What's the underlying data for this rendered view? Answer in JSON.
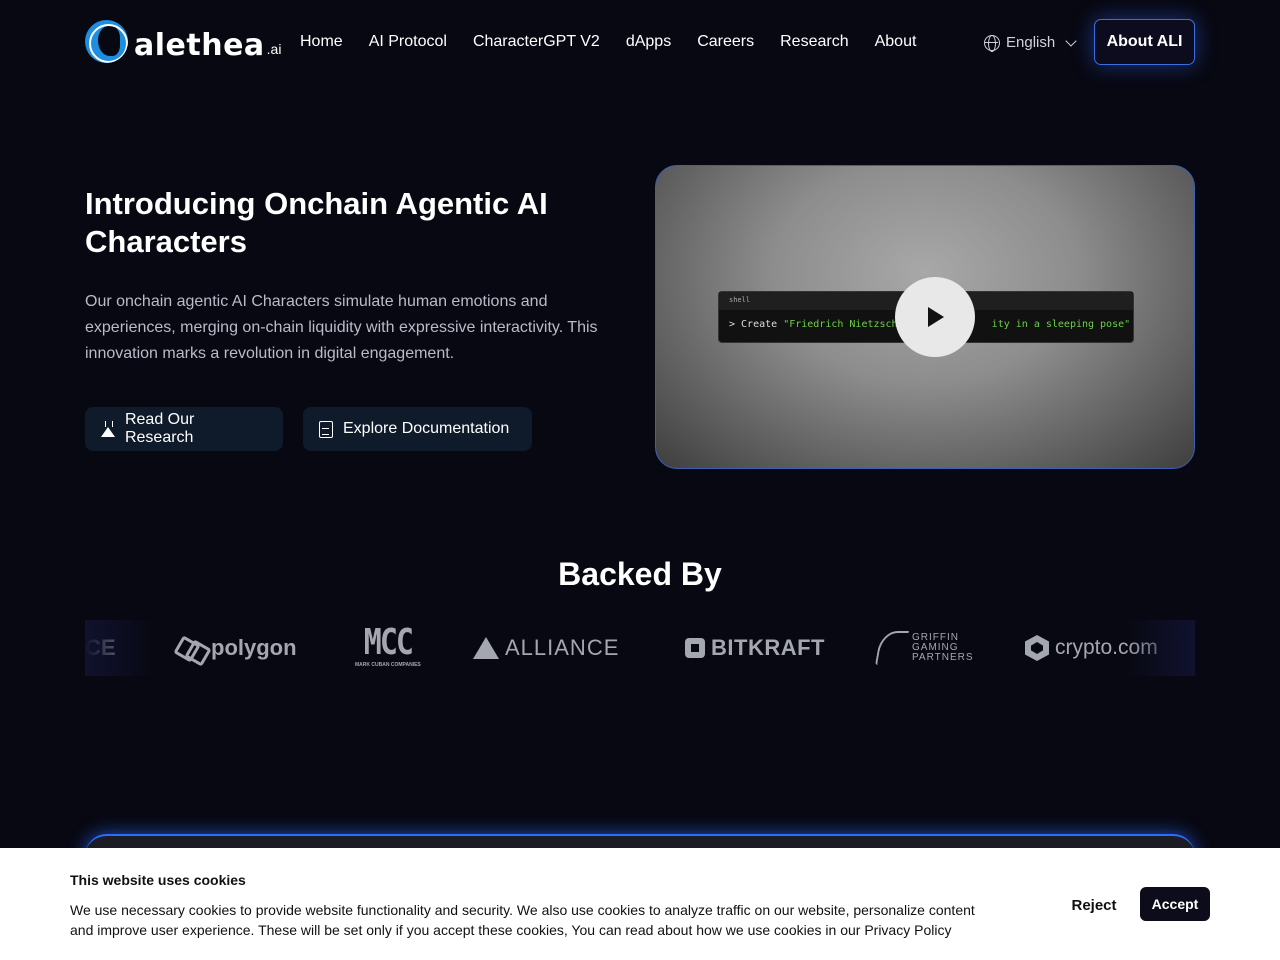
{
  "header": {
    "logo_text": "alethea",
    "logo_suffix": ".ai",
    "nav": [
      "Home",
      "AI Protocol",
      "CharacterGPT V2",
      "dApps",
      "Careers",
      "Research",
      "About"
    ],
    "language": "English",
    "cta": "About ALI"
  },
  "hero": {
    "title": "Introducing Onchain Agentic AI Characters",
    "description": "Our onchain agentic AI Characters simulate human emotions and experiences, merging on-chain liquidity with expressive interactivity. This innovation marks a revolution in digital engagement.",
    "buttons": {
      "research": "Read Our Research",
      "docs": "Explore Documentation"
    },
    "video": {
      "terminal_tab": "shell",
      "prompt": "> Create ",
      "command_start": "\"Friedrich Nietzsche, w",
      "command_end": "ity in a sleeping pose\""
    }
  },
  "backed": {
    "title": "Backed By",
    "logos": {
      "partial": "CE",
      "polygon": "polygon",
      "mcc": "MCC",
      "mcc_sub": "MARK CUBAN COMPANIES",
      "alliance": "ALLIANCE",
      "bitkraft": "BITKRAFT",
      "griffin_1": "GRIFFIN",
      "griffin_2": "GAMING",
      "griffin_3": "PARTNERS",
      "crypto": "crypto.com"
    }
  },
  "cookie": {
    "title": "This website uses cookies",
    "text": "We use necessary cookies to provide website functionality and security. We also use cookies to analyze traffic on our website, personalize content and improve user experience. These will be set only if you accept these cookies, You can read about how we use cookies in our Privacy Policy",
    "reject": "Reject",
    "accept": "Accept"
  }
}
